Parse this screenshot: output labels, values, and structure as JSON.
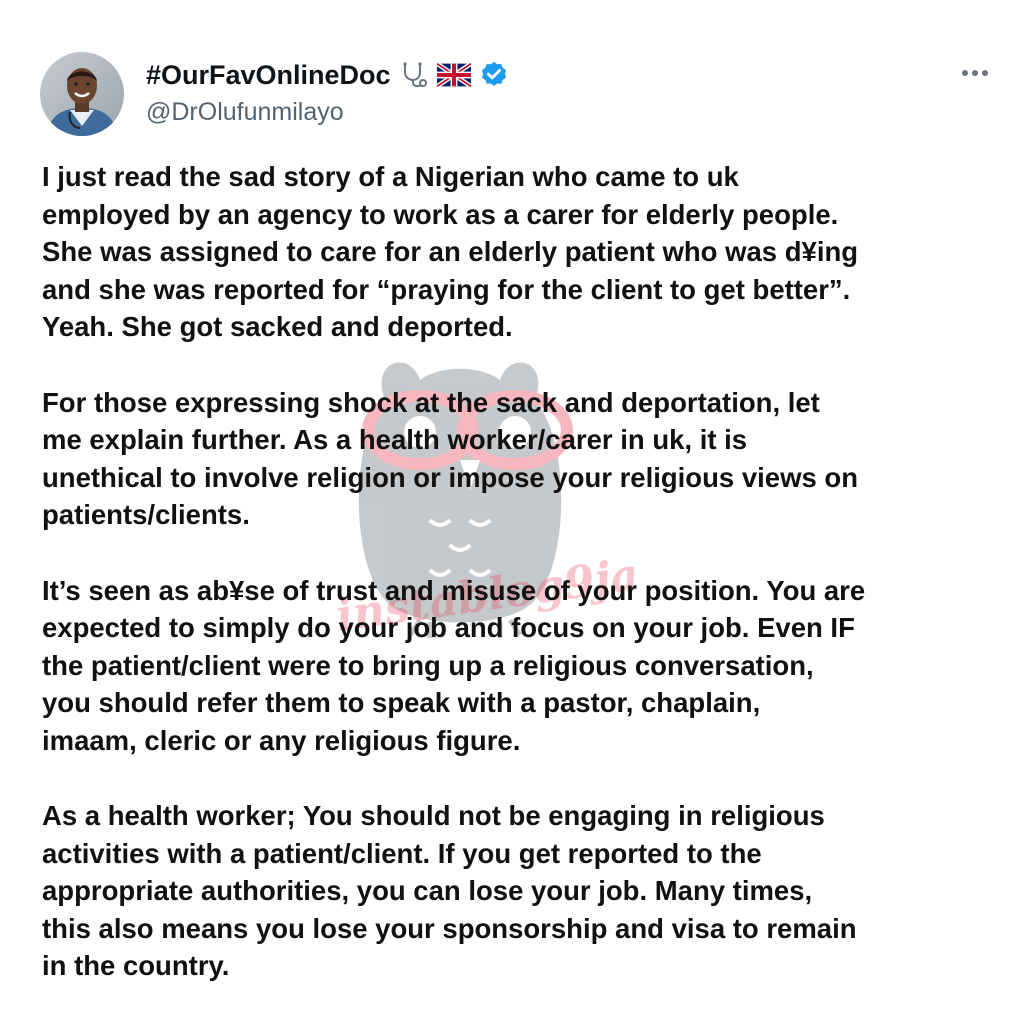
{
  "header": {
    "display_name": "#OurFavOnlineDoc",
    "handle": "@DrOlufunmilayo",
    "verified": true,
    "emoji_icons": [
      "stethoscope-icon",
      "uk-flag-icon"
    ],
    "verified_color": "#1d9bf0"
  },
  "watermark": {
    "text": "instablog9ja",
    "color": "#e8334a"
  },
  "tweet": {
    "paragraphs": [
      {
        "lines": [
          "I just read the sad story of a Nigerian who came to uk",
          "employed by an agency to work as a carer for elderly people.",
          "She was assigned to care for an elderly patient who was d¥ing",
          "and she was reported for “praying for the client to get better”.",
          "Yeah. She got sacked and deported."
        ]
      },
      {
        "lines": [
          "For those expressing shock at the sack and deportation, let",
          "me explain further. As a health worker/carer in uk, it is",
          "unethical to involve religion or impose your religious views on",
          "patients/clients."
        ]
      },
      {
        "lines": [
          "It’s seen as ab¥se of trust and misuse of your position. You are",
          "expected to simply do your job and focus on your job. Even IF",
          "the patient/client were to bring up a religious conversation,",
          "you should refer them to speak with a pastor, chaplain,",
          "imaam, cleric or any religious figure."
        ]
      },
      {
        "lines": [
          "As a health worker; You should not be engaging in religious",
          "activities with a patient/client. If you get reported to the",
          "appropriate authorities, you can lose your job. Many times,",
          "this also means you lose your sponsorship and visa to remain",
          "in the country."
        ]
      }
    ]
  }
}
